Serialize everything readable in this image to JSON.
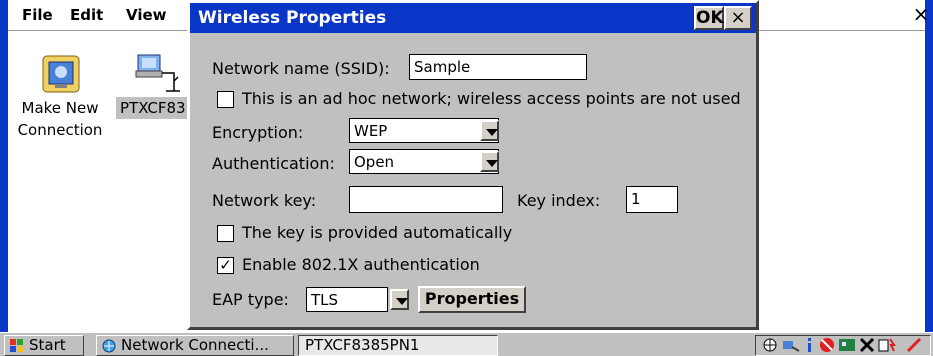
{
  "menu": {
    "file": "File",
    "edit": "Edit",
    "view": "View",
    "close_glyph": "×"
  },
  "explorer": {
    "icons": [
      {
        "label_line1": "Make New",
        "label_line2": "Connection"
      },
      {
        "label_line1": "PTXCF83"
      }
    ]
  },
  "dialog": {
    "title": "Wireless Properties",
    "ok_label": "OK",
    "close_glyph": "×",
    "ssid_label": "Network name (SSID):",
    "ssid_value": "Sample",
    "adhoc_label": "This is an ad hoc network; wireless access points are not used",
    "adhoc_checked": false,
    "encryption_label": "Encryption:",
    "encryption_value": "WEP",
    "auth_label": "Authentication:",
    "auth_value": "Open",
    "netkey_label": "Network key:",
    "netkey_value": "",
    "keyindex_label": "Key index:",
    "keyindex_value": "1",
    "autokey_label": "The key is provided automatically",
    "autokey_checked": false,
    "enable8021x_label": "Enable 802.1X authentication",
    "enable8021x_checked": true,
    "check_glyph": "✓",
    "eap_label": "EAP type:",
    "eap_value": "TLS",
    "properties_label": "Properties"
  },
  "taskbar": {
    "start_label": "Start",
    "task1_label": "Network Connecti...",
    "task2_label": "PTXCF8385PN1"
  },
  "colors": {
    "title_blue": "#0a36c8",
    "dialog_gray": "#c0c0c0"
  }
}
